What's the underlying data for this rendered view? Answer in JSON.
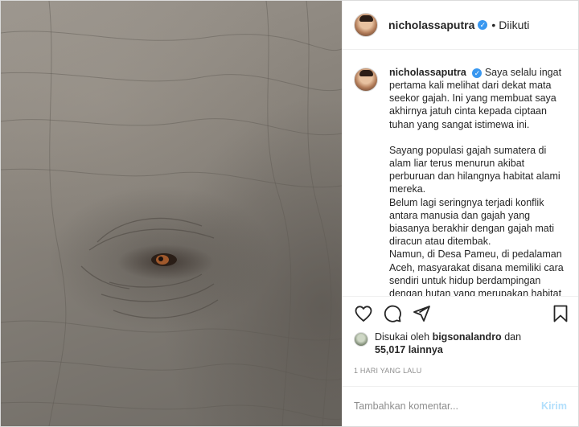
{
  "post": {
    "username": "nicholassaputra",
    "verified": true,
    "header_separator": "•",
    "follow_status": "Diikuti"
  },
  "caption": {
    "username": "nicholassaputra",
    "paragraphs": [
      "Saya selalu ingat pertama kali melihat dari dekat mata seekor gajah. Ini yang membuat saya akhirnya jatuh cinta kepada ciptaan tuhan yang sangat istimewa ini.",
      "",
      "Sayang populasi gajah sumatera di alam liar terus menurun akibat perburuan dan hilangnya habitat alami mereka.",
      "Belum lagi seringnya terjadi konflik antara manusia dan gajah yang biasanya berakhir dengan gajah mati diracun atau ditembak.",
      "Namun, di Desa Pameu, di pedalaman Aceh, masyarakat disana memiliki cara sendiri untuk hidup berdampingan dengan hutan yang merupakan habitat gajah sumatera."
    ]
  },
  "actions": {
    "like_icon": "heart-icon",
    "comment_icon": "comment-bubble-icon",
    "share_icon": "paper-plane-icon",
    "save_icon": "bookmark-icon"
  },
  "likes": {
    "prefix": "Disukai oleh",
    "liked_by": "bigsonalandro",
    "conjunction": "dan",
    "count": "55,017 lainnya"
  },
  "timestamp": "1 HARI YANG LALU",
  "comment_box": {
    "placeholder": "Tambahkan komentar...",
    "post_label": "Kirim"
  },
  "colors": {
    "verified_blue": "#3897f0",
    "post_button_disabled": "#b2dffc",
    "muted_text": "#8e8e8e",
    "border": "#dbdbdb"
  }
}
